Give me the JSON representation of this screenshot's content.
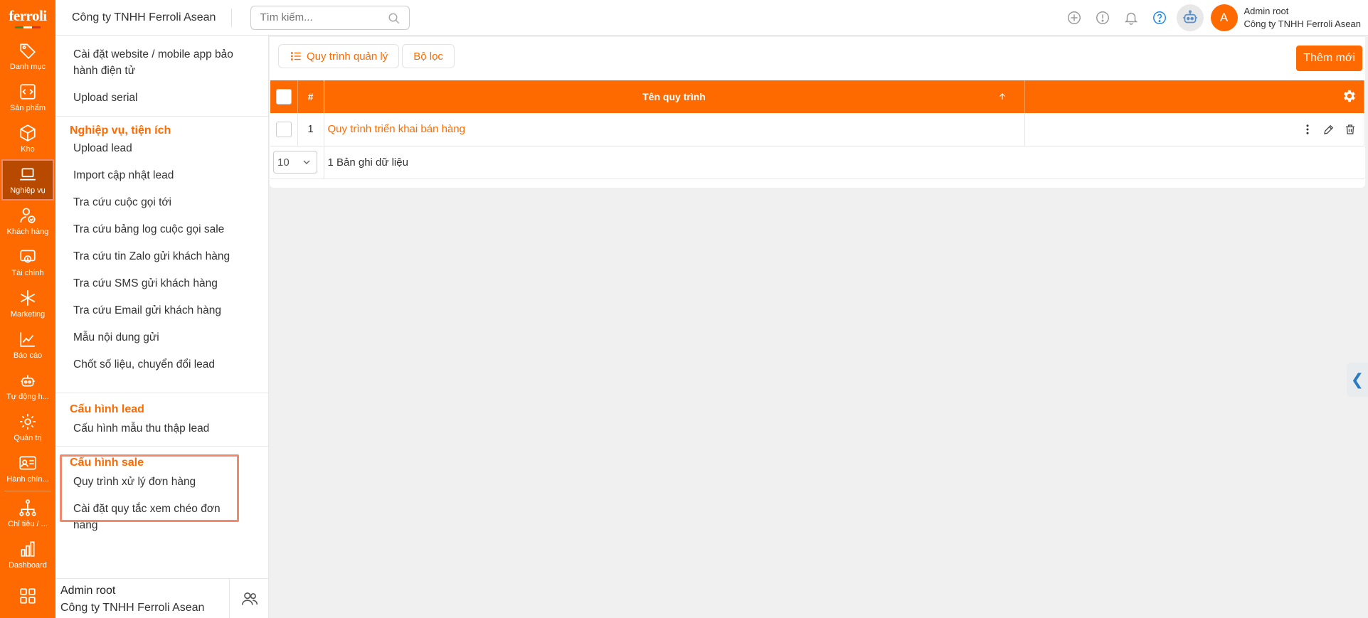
{
  "brand": {
    "logo_text": "ferroli",
    "accent": "#ff6a00"
  },
  "rail": {
    "items": [
      {
        "label": "Danh mục",
        "icon": "tag-icon"
      },
      {
        "label": "Sản phẩm",
        "icon": "code-icon"
      },
      {
        "label": "Kho",
        "icon": "box-icon"
      },
      {
        "label": "Nghiệp vụ",
        "icon": "laptop-icon",
        "active": true
      },
      {
        "label": "Khách hàng",
        "icon": "user-check-icon"
      },
      {
        "label": "Tài chính",
        "icon": "money-icon"
      },
      {
        "label": "Marketing",
        "icon": "asterisk-icon"
      },
      {
        "label": "Báo cáo",
        "icon": "line-chart-icon"
      },
      {
        "label": "Tự động h...",
        "icon": "robot-icon"
      },
      {
        "label": "Quản trị",
        "icon": "gear-icon"
      },
      {
        "label": "Hành chín...",
        "icon": "id-card-icon"
      },
      {
        "label": "Chỉ tiêu / ...",
        "icon": "hierarchy-icon"
      },
      {
        "label": "Dashboard",
        "icon": "bar-chart-icon"
      }
    ]
  },
  "header": {
    "company": "Công ty TNHH Ferroli Asean",
    "search_placeholder": "Tìm kiếm...",
    "user_name": "Admin root",
    "user_company": "Công ty TNHH Ferroli Asean",
    "avatar_letter": "A"
  },
  "submenu": {
    "top_items": [
      "Cài đặt website / mobile app bảo hành điện tử",
      "Upload serial"
    ],
    "section1_title": "Nghiệp vụ, tiện ích",
    "section1_items": [
      "Upload lead",
      "Import cập nhật lead",
      "Tra cứu cuộc gọi tới",
      "Tra cứu bảng log cuộc gọi sale",
      "Tra cứu tin Zalo gửi khách hàng",
      "Tra cứu SMS gửi khách hàng",
      "Tra cứu Email gửi khách hàng",
      "Mẫu nội dung gửi",
      "Chốt số liệu, chuyển đổi lead"
    ],
    "section2_title": "Cấu hình lead",
    "section2_items": [
      "Cấu hình mẫu thu thập lead"
    ],
    "section3_title": "Cấu hình sale",
    "section3_items": [
      "Quy trình xử lý đơn hàng",
      "Cài đặt quy tắc xem chéo đơn hàng"
    ],
    "footer_name": "Admin root",
    "footer_company": "Công ty TNHH Ferroli Asean"
  },
  "main": {
    "tab_manage": "Quy trình quản lý",
    "tab_filter": "Bộ lọc",
    "new_button": "Thêm mới",
    "table": {
      "col_index": "#",
      "col_name": "Tên quy trình",
      "rows": [
        {
          "index": "1",
          "name": "Quy trình triển khai bán hàng"
        }
      ],
      "page_size": "10",
      "record_count": "1 Bản ghi dữ liệu"
    }
  }
}
